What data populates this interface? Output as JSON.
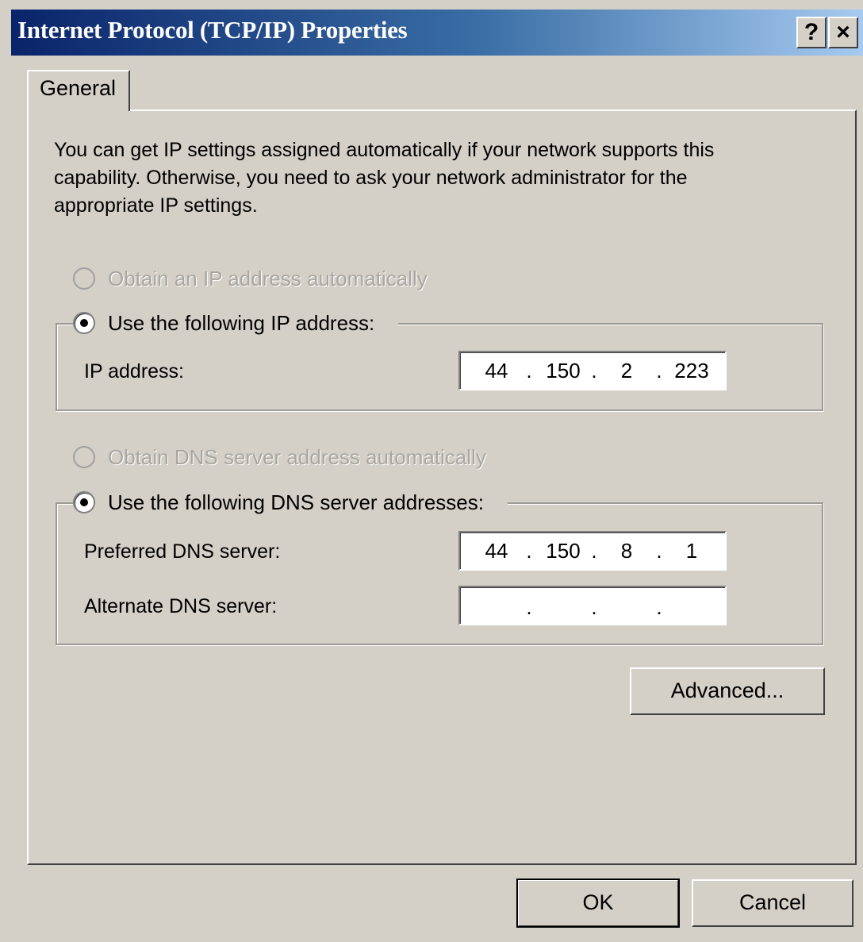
{
  "window": {
    "title": "Internet Protocol (TCP/IP) Properties",
    "help_label": "?",
    "close_label": "×"
  },
  "tabs": [
    {
      "label": "General"
    }
  ],
  "description": "You can get IP settings assigned automatically if your network supports this capability. Otherwise, you need to ask your network administrator for the appropriate IP settings.",
  "ip": {
    "auto_label": "Obtain an IP address automatically",
    "auto_selected": false,
    "manual_label": "Use the following IP address:",
    "manual_selected": true,
    "address_label": "IP address:",
    "address": [
      "44",
      "150",
      "2",
      "223"
    ]
  },
  "dns": {
    "auto_label": "Obtain DNS server address automatically",
    "auto_selected": false,
    "manual_label": "Use the following DNS server addresses:",
    "manual_selected": true,
    "preferred_label": "Preferred DNS server:",
    "preferred": [
      "44",
      "150",
      "8",
      "1"
    ],
    "alternate_label": "Alternate DNS server:",
    "alternate": [
      "",
      "",
      "",
      ""
    ]
  },
  "buttons": {
    "advanced": "Advanced...",
    "ok": "OK",
    "cancel": "Cancel"
  },
  "colors": {
    "titlebar_start": "#0a246a",
    "titlebar_end": "#a6caf0",
    "dialog_bg": "#d4d0c8",
    "disabled_text": "#a8a6a0"
  }
}
